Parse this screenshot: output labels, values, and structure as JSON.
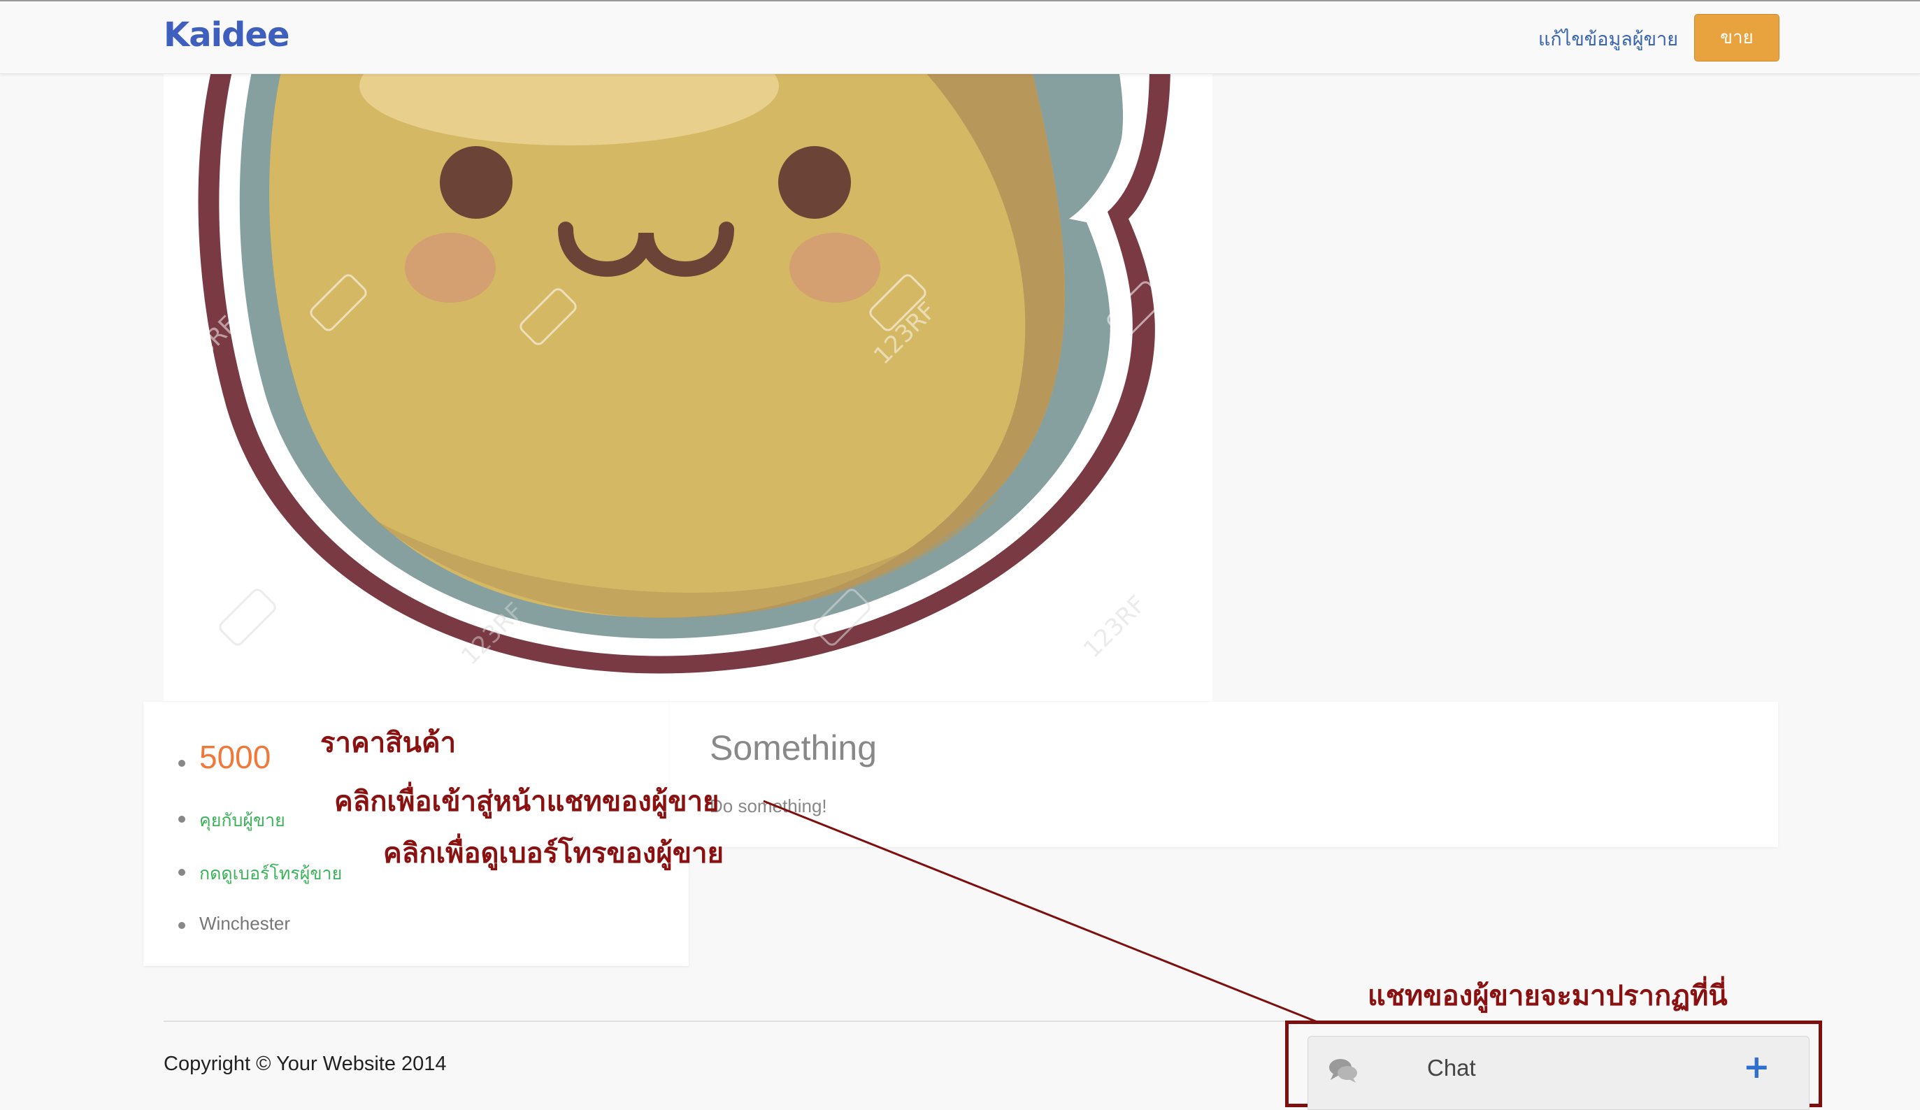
{
  "header": {
    "logo": "Kaidee",
    "edit_seller_link": "แก้ไขข้อมูลผู้ขาย",
    "sell_button": "ขาย"
  },
  "product": {
    "image_icon": "kawaii-dumpling-illustration",
    "watermark_text": "123RF",
    "price": "5000",
    "chat_seller_link": "คุยกับผู้ขาย",
    "show_phone_link": "กดดูเบอร์โทรผู้ขาย",
    "location": "Winchester"
  },
  "description": {
    "title": "Something",
    "body": "Do something!"
  },
  "annotations": {
    "price_note": "ราคาสินค้า",
    "chat_note": "คลิกเพื่อเข้าสู่หน้าแชทของผู้ขาย",
    "phone_note": "คลิกเพื่อดูเบอร์โทรของผู้ขาย",
    "chat_location_note": "แชทของผู้ขายจะมาปรากฏที่นี่"
  },
  "footer": {
    "copyright": "Copyright © Your Website 2014"
  },
  "chat": {
    "label": "Chat",
    "toggle_icon": "plus-icon",
    "icon": "speech-bubbles-icon"
  },
  "colors": {
    "logo": "#3f5fbf",
    "sell_button": "#e8a23e",
    "price": "#f0793a",
    "link_green": "#3bb35a",
    "annotation": "#8b1010"
  }
}
